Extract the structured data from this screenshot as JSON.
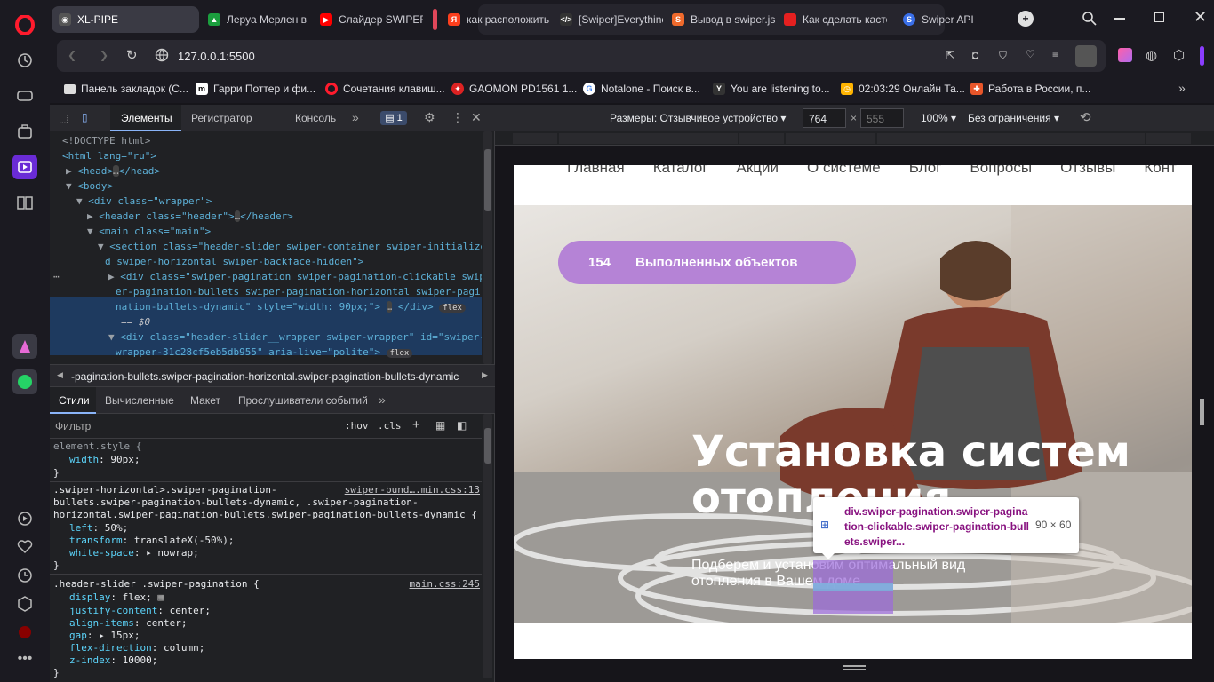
{
  "tabs": [
    {
      "title": "XL-PIPE",
      "active": true
    },
    {
      "title": "Леруа Мерлен в"
    },
    {
      "title": "Слайдер SWIPER"
    },
    {
      "title": "как расположить"
    },
    {
      "title": "[Swiper]Everythinc"
    },
    {
      "title": "Вывод в swiper.js"
    },
    {
      "title": "Как сделать касто"
    },
    {
      "title": "Swiper API"
    }
  ],
  "address": {
    "url": "127.0.0.1:5500"
  },
  "bookmarks": [
    {
      "label": "Панель закладок (C..."
    },
    {
      "label": "Гарри Поттер и фи..."
    },
    {
      "label": "Сочетания клавиш..."
    },
    {
      "label": "GAOMON PD1561 1..."
    },
    {
      "label": "Notalone - Поиск в..."
    },
    {
      "label": "You are listening to..."
    },
    {
      "label": "02:03:29 Онлайн Та..."
    },
    {
      "label": "Работа в России, п..."
    }
  ],
  "devtools": {
    "tabs": [
      "Элементы",
      "Регистратор",
      "Консоль"
    ],
    "issues_count": "1",
    "dom": [
      "<!DOCTYPE html>",
      "<html lang=\"ru\">",
      "<head>",
      "</head>",
      "<body>",
      "<div class=\"wrapper\">",
      "<header class=\"header\">",
      "</header>",
      "<main class=\"main\">",
      "<section class=\"header-slider swiper-container swiper-initialize",
      "d swiper-horizontal swiper-backface-hidden\">",
      "<div class=\"swiper-pagination swiper-pagination-clickable swip",
      "er-pagination-bullets swiper-pagination-horizontal swiper-pagi",
      "nation-bullets-dynamic\" style=\"width: 90px;\">",
      "</div>",
      "== $0",
      "<div class=\"header-slider__wrapper swiper-wrapper\" id=\"swiper-",
      "wrapper-31c28cf5eb5db955\" aria-live=\"polite\">",
      "flex"
    ],
    "breadcrumb": "-pagination-bullets.swiper-pagination-horizontal.swiper-pagination-bullets-dynamic",
    "style_tabs": [
      "Стили",
      "Вычисленные",
      "Макет",
      "Прослушиватели событий"
    ],
    "filter_placeholder": "Фильтр",
    "filter_buttons": [
      ":hov",
      ".cls"
    ],
    "rules": [
      {
        "selector": "element.style {",
        "props": [
          [
            "width",
            "90px"
          ]
        ]
      },
      {
        "selector_lines": [
          ".swiper-horizontal>.swiper-pagination-",
          "bullets.swiper-pagination-bullets-dynamic, .swiper-pagination-",
          "horizontal.swiper-pagination-bullets.swiper-pagination-bullets-dynamic {"
        ],
        "source": "swiper-bund….min.css:13",
        "props": [
          [
            "left",
            "50%"
          ],
          [
            "transform",
            "translateX(-50%)"
          ],
          [
            "white-space",
            "nowrap"
          ]
        ]
      },
      {
        "selector": ".header-slider .swiper-pagination {",
        "source": "main.css:245",
        "props": [
          [
            "display",
            "flex"
          ],
          [
            "justify-content",
            "center"
          ],
          [
            "align-items",
            "center"
          ],
          [
            "gap",
            "15px"
          ],
          [
            "flex-direction",
            "column"
          ],
          [
            "z-index",
            "10000"
          ]
        ]
      }
    ]
  },
  "device_toolbar": {
    "dimensions_label": "Размеры: Отзывчивое устройство",
    "width": "764",
    "height": "555",
    "zoom": "100%",
    "throttle": "Без ограничения"
  },
  "site": {
    "nav": [
      "Главная",
      "Каталог",
      "Акции",
      "О системе",
      "Блог",
      "Вопросы",
      "Отзывы",
      "Конт"
    ],
    "badge_number": "154",
    "badge_text": "Выполненных объектов",
    "hero_title_1": "Установка систем",
    "hero_title_2": "отопления",
    "hero_sub_1": "Подберем и установим оптимальный вид",
    "hero_sub_2": "отопления в Вашем доме"
  },
  "inspect_tooltip": {
    "selector": "div.swiper-pagination.swiper-pagination-clickable.swiper-pagination-bullets.swiper...",
    "size": "90 × 60"
  },
  "colors": {
    "accent": "#b583d6",
    "devtools_bg": "#202124",
    "selection": "#1e3a5f"
  }
}
